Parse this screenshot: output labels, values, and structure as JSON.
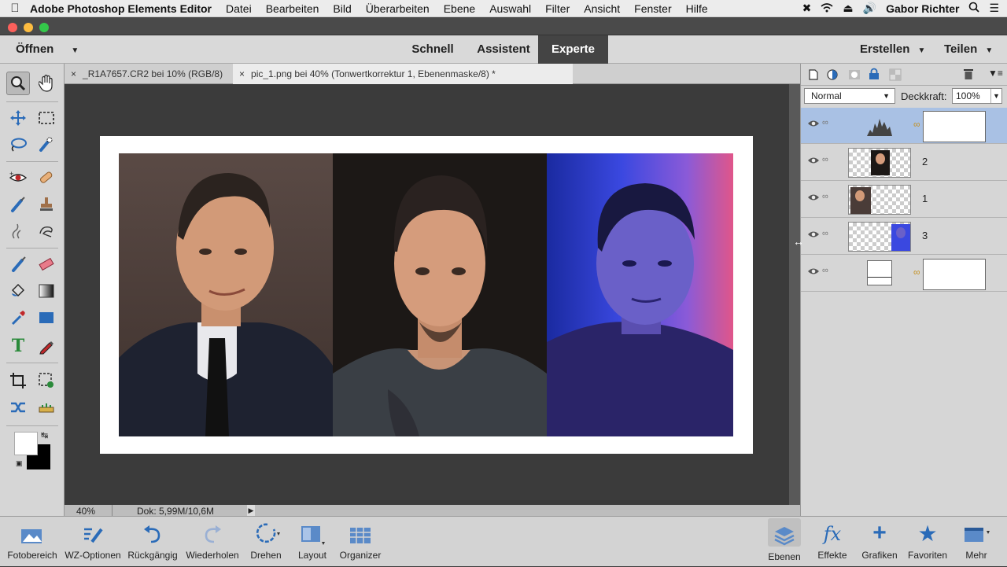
{
  "menubar": {
    "app_name": "Adobe Photoshop Elements Editor",
    "items": [
      "Datei",
      "Bearbeiten",
      "Bild",
      "Überarbeiten",
      "Ebene",
      "Auswahl",
      "Filter",
      "Ansicht",
      "Fenster",
      "Hilfe"
    ],
    "user": "Gabor Richter"
  },
  "modebar": {
    "open_label": "Öffnen",
    "modes": [
      "Schnell",
      "Assistent",
      "Experte"
    ],
    "active_mode": "Experte",
    "create_label": "Erstellen",
    "share_label": "Teilen"
  },
  "document_tabs": [
    {
      "label": "_R1A7657.CR2 bei 10% (RGB/8)",
      "active": false
    },
    {
      "label": "pic_1.png bei 40% (Tonwertkorrektur 1, Ebenenmaske/8) *",
      "active": true
    }
  ],
  "status": {
    "zoom": "40%",
    "doc_info": "Dok: 5,99M/10,6M"
  },
  "layers_panel": {
    "blend_mode": "Normal",
    "opacity_label": "Deckkraft:",
    "opacity_value": "100%",
    "layers": [
      {
        "name": "",
        "kind": "adjustment",
        "selected": true
      },
      {
        "name": "2",
        "kind": "image",
        "selected": false
      },
      {
        "name": "1",
        "kind": "image",
        "selected": false
      },
      {
        "name": "3",
        "kind": "image",
        "selected": false
      },
      {
        "name": "",
        "kind": "background",
        "selected": false
      }
    ]
  },
  "bottombar": {
    "left": [
      "Fotobereich",
      "WZ-Optionen",
      "Rückgängig",
      "Wiederholen",
      "Drehen",
      "Layout",
      "Organizer"
    ],
    "right": [
      "Ebenen",
      "Effekte",
      "Grafiken",
      "Favoriten",
      "Mehr"
    ]
  },
  "colors": {
    "accent": "#444444",
    "selected_layer": "#a9c1e4",
    "canvas_bg": "#3b3b3b"
  }
}
